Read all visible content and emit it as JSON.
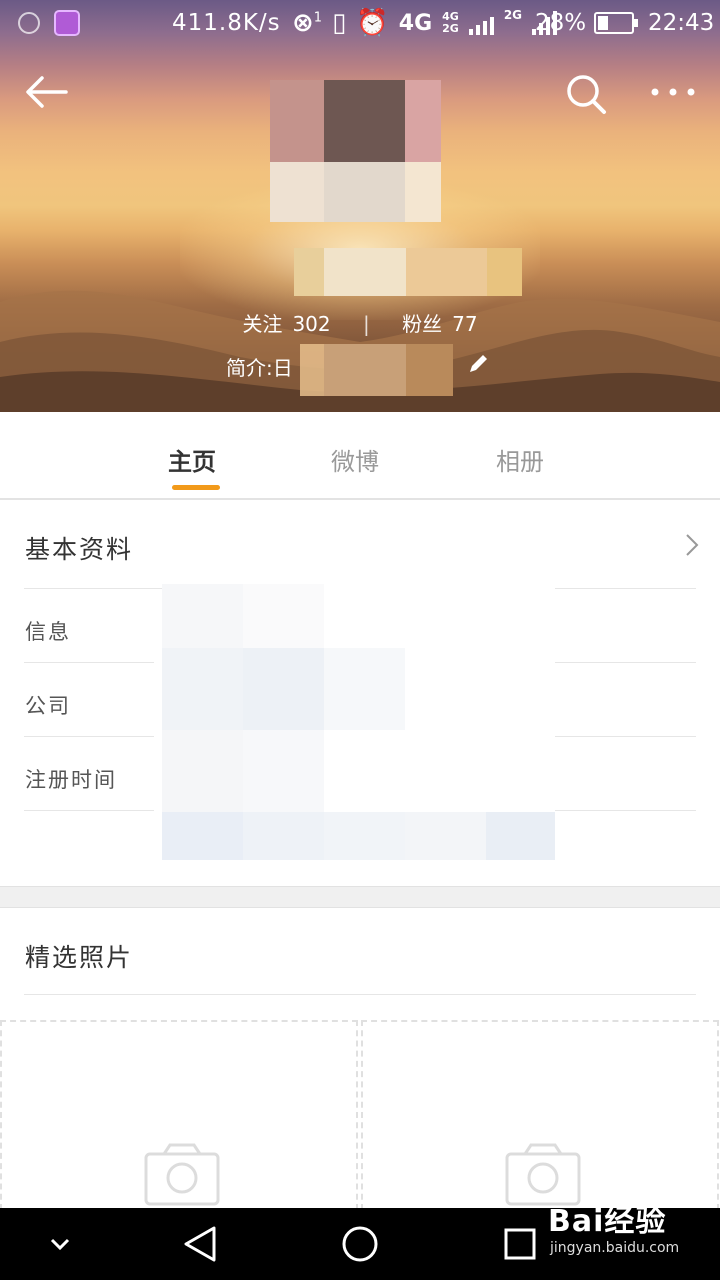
{
  "status_bar": {
    "net_speed": "411.8K/s",
    "network_1": "4G",
    "network_2": "4G",
    "network_3": "2G",
    "network_4": "2G",
    "sim_badge": "1",
    "battery": "28%",
    "time": "22:43"
  },
  "profile": {
    "follow_label": "关注",
    "follow_count": "302",
    "fans_label": "粉丝",
    "fans_count": "77",
    "bio_prefix": "简介:日"
  },
  "tabs": [
    {
      "label": "主页",
      "active": true
    },
    {
      "label": "微博",
      "active": false
    },
    {
      "label": "相册",
      "active": false
    }
  ],
  "basic_info": {
    "title": "基本资料",
    "rows": [
      {
        "label": "信息"
      },
      {
        "label": "公司"
      },
      {
        "label": "注册时间"
      }
    ]
  },
  "photos": {
    "title": "精选照片"
  },
  "watermark": {
    "logo": "Bai经验",
    "url": "jingyan.baidu.com"
  },
  "colors": {
    "accent_underline": "#f29a1a",
    "hero_top": "#6b5a86",
    "hero_mid": "#f2c27e",
    "hero_bottom": "#5b3d2c"
  },
  "icons": [
    "back-arrow-icon",
    "search-icon",
    "more-dots-icon",
    "edit-pencil-icon",
    "chevron-right-icon",
    "camera-icon",
    "nav-back-icon",
    "nav-home-icon",
    "nav-recents-icon",
    "nav-collapse-icon"
  ]
}
